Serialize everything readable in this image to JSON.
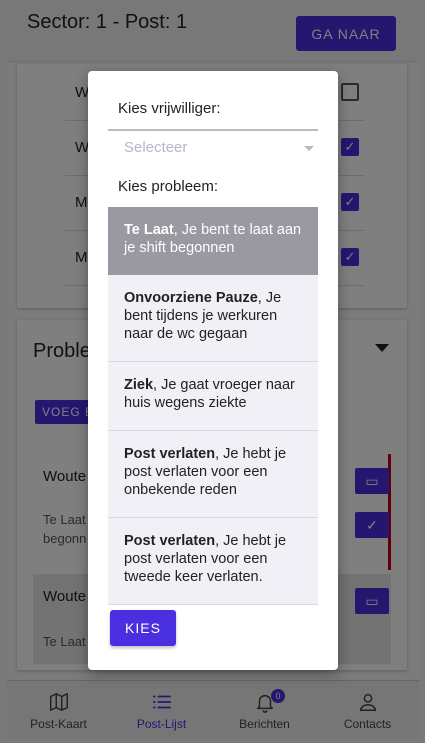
{
  "header": {
    "title": "Sector: 1 - Post: 1",
    "goto_label": "GA NAAR"
  },
  "volunteers": {
    "items": [
      {
        "name": "Wo",
        "checked": false
      },
      {
        "name": "Wo",
        "checked": true
      },
      {
        "name": "Ma",
        "checked": true
      },
      {
        "name": "Ma",
        "checked": true
      }
    ]
  },
  "problems_card": {
    "title": "Proble",
    "add_label": "VOEG B",
    "items": [
      {
        "name": "Woute",
        "desc": "Te Laat\nbegonn"
      },
      {
        "name": "Woute",
        "desc": "Te Laat"
      }
    ]
  },
  "dialog": {
    "volunteer_label": "Kies vrijwilliger:",
    "select_placeholder": "Selecteer",
    "problem_label": "Kies probleem:",
    "options": [
      {
        "title": "Te Laat",
        "rest": ", Je bent te laat aan je shift begonnen",
        "selected": true
      },
      {
        "title": "Onvoorziene Pauze",
        "rest": ", Je bent tijdens je werkuren naar de wc gegaan",
        "selected": false
      },
      {
        "title": "Ziek",
        "rest": ", Je gaat vroeger naar huis wegens ziekte",
        "selected": false
      },
      {
        "title": "Post verlaten",
        "rest": ", Je hebt je post verlaten voor een onbekende reden",
        "selected": false
      },
      {
        "title": "Post verlaten",
        "rest": ", Je hebt je post verlaten voor een tweede keer verlaten.",
        "selected": false
      }
    ],
    "submit_label": "KIES"
  },
  "bottom_nav": {
    "items": [
      {
        "label": "Post-Kaart",
        "icon": "map-icon",
        "active": false
      },
      {
        "label": "Post-Lijst",
        "icon": "list-icon",
        "active": true
      },
      {
        "label": "Berichten",
        "icon": "bell-icon",
        "active": false,
        "badge": "0"
      },
      {
        "label": "Contacts",
        "icon": "person-icon",
        "active": false
      }
    ]
  },
  "colors": {
    "accent": "#4a2fe0",
    "danger": "#c2001b",
    "selected_option": "#9a98a0"
  }
}
